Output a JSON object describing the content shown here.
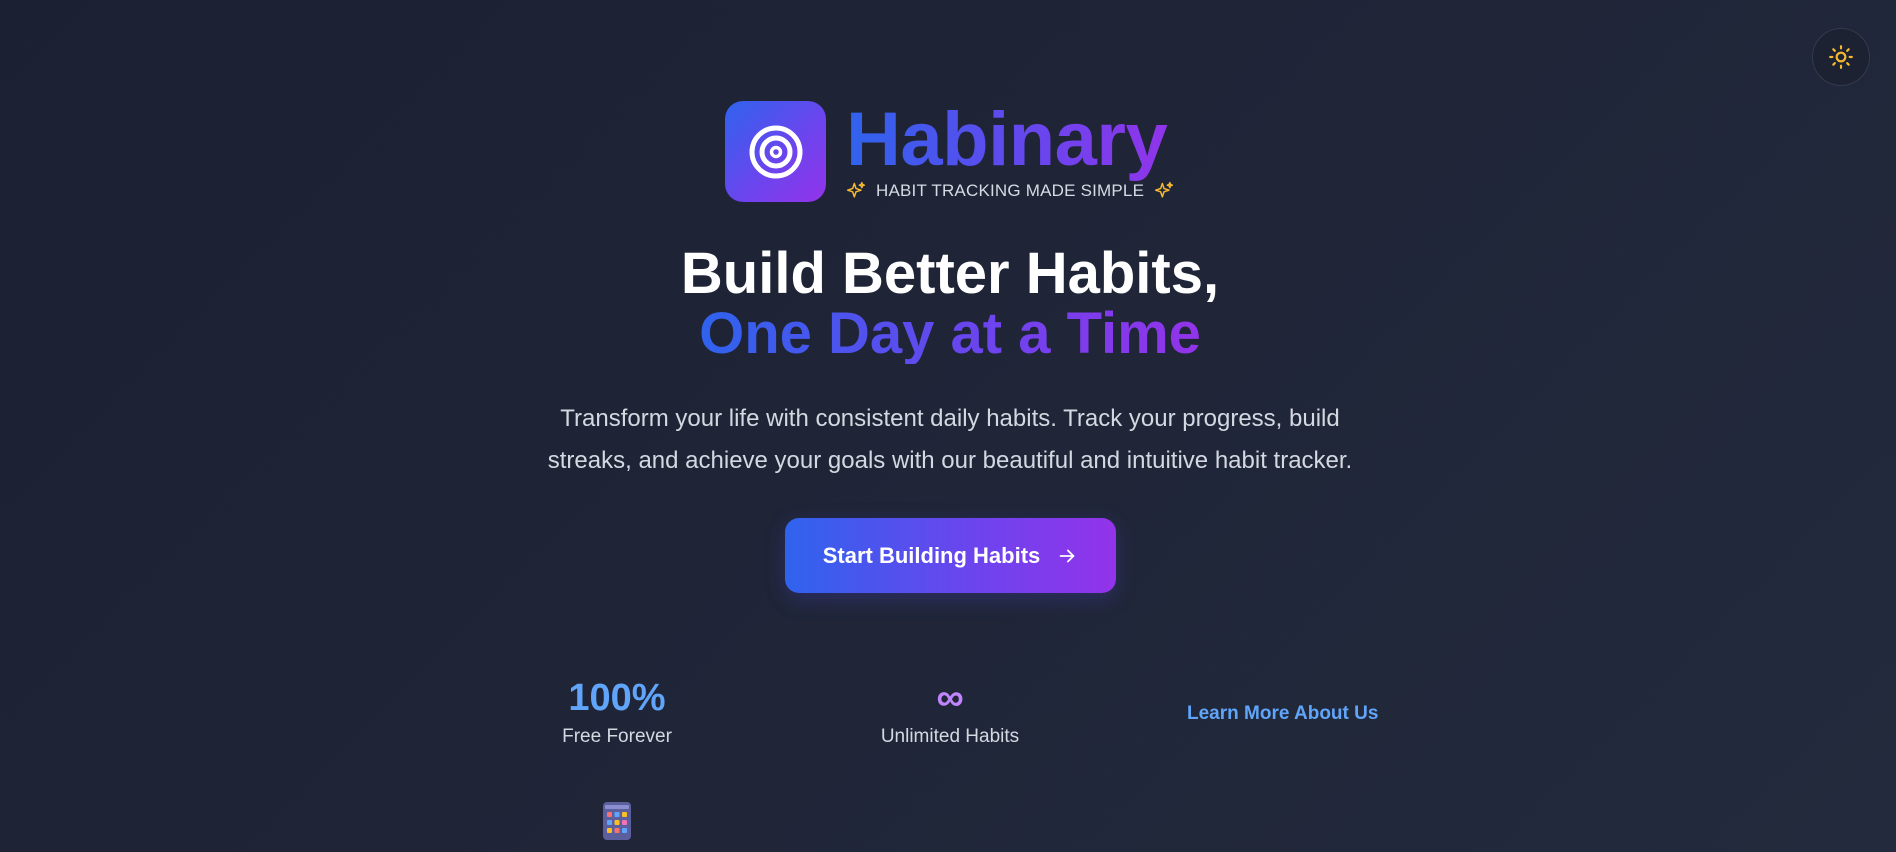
{
  "brand": {
    "name": "Habinary",
    "tagline": "HABIT TRACKING MADE SIMPLE",
    "logo_icon": "target-icon"
  },
  "theme_toggle": {
    "icon": "sun-icon"
  },
  "hero": {
    "headline_line1": "Build Better Habits,",
    "headline_line2": "One Day at a Time",
    "subtext_line1": "Transform your life with consistent daily habits. Track your progress, build",
    "subtext_line2": "streaks, and achieve your goals with our beautiful and intuitive habit tracker."
  },
  "cta": {
    "label": "Start Building Habits",
    "icon": "arrow-right-icon"
  },
  "stats": [
    {
      "value": "100%",
      "label": "Free Forever"
    },
    {
      "value": "∞",
      "label": "Unlimited Habits"
    }
  ],
  "learn_more": "Learn More About Us",
  "colors": {
    "accent_blue": "#2f63ee",
    "accent_purple": "#9333ea",
    "stat_blue": "#60a5fa",
    "stat_purple": "#c084fc",
    "sparkle": "#f5b82e"
  }
}
